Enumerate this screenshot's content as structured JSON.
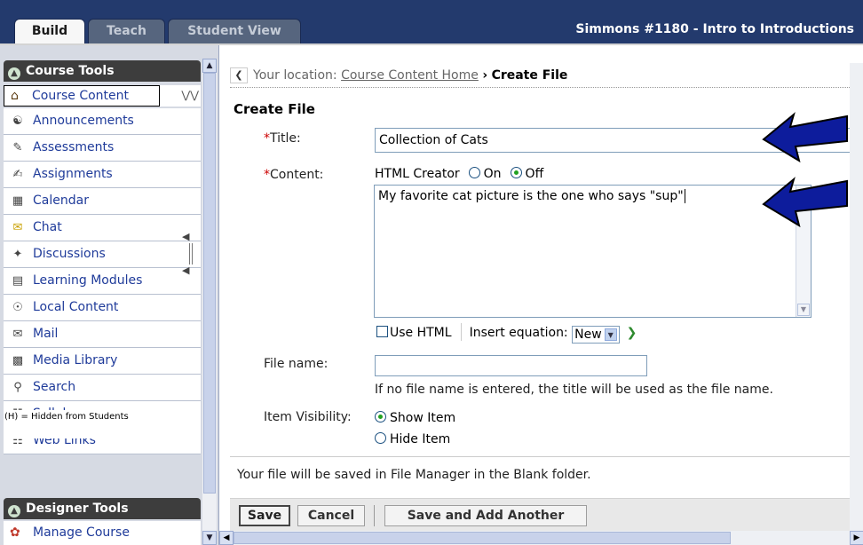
{
  "tabs": [
    {
      "label": "Build",
      "active": true
    },
    {
      "label": "Teach",
      "active": false
    },
    {
      "label": "Student View",
      "active": false
    }
  ],
  "course_title": "Simmons #1180 - Intro to Introductions",
  "sidebar": {
    "course_tools_label": "Course Tools",
    "current_tool": "Course Content",
    "items": [
      {
        "label": "Announcements",
        "icon": "announcements-icon"
      },
      {
        "label": "Assessments",
        "icon": "assessments-icon"
      },
      {
        "label": "Assignments",
        "icon": "assignments-icon"
      },
      {
        "label": "Calendar",
        "icon": "calendar-icon"
      },
      {
        "label": "Chat",
        "icon": "chat-icon"
      },
      {
        "label": "Discussions",
        "icon": "discussions-icon"
      },
      {
        "label": "Learning Modules",
        "icon": "learning-modules-icon"
      },
      {
        "label": "Local Content",
        "icon": "local-content-icon"
      },
      {
        "label": "Mail",
        "icon": "mail-icon"
      },
      {
        "label": "Media Library",
        "icon": "media-library-icon"
      },
      {
        "label": "Search",
        "icon": "search-icon"
      },
      {
        "label": "Syllabus",
        "icon": "syllabus-icon"
      },
      {
        "label": "Web Links",
        "icon": "web-links-icon"
      }
    ],
    "hidden_note": "(H) = Hidden from Students",
    "designer_tools_label": "Designer Tools",
    "manage_course": "Manage Course"
  },
  "location": {
    "prefix": "Your location:",
    "home_link": "Course Content Home",
    "separator": "›",
    "current": "Create File"
  },
  "form": {
    "heading": "Create File",
    "required_mark": "*",
    "title_label": "Title:",
    "title_value": "Collection of Cats",
    "content_label": "Content:",
    "html_creator_label": "HTML Creator",
    "radio_on_label": "On",
    "radio_off_label": "Off",
    "html_creator_value": "Off",
    "content_value": "My favorite cat picture is the one who says \"sup\"",
    "use_html_label": "Use HTML",
    "insert_equation_label": "Insert equation:",
    "equation_select_value": "New",
    "file_name_label": "File name:",
    "file_name_value": "",
    "file_name_hint": "If no file name is entered, the title will be used as the file name.",
    "visibility_label": "Item Visibility:",
    "show_item_label": "Show Item",
    "hide_item_label": "Hide Item",
    "visibility_value": "Show Item",
    "save_note": "Your file will be saved in File Manager in the Blank folder."
  },
  "buttons": {
    "save": "Save",
    "cancel": "Cancel",
    "save_add": "Save and Add Another"
  },
  "colors": {
    "header_bg": "#233a6d",
    "link": "#1f3b9a",
    "required": "#cc0000",
    "arrow": "#0d1c9c"
  }
}
